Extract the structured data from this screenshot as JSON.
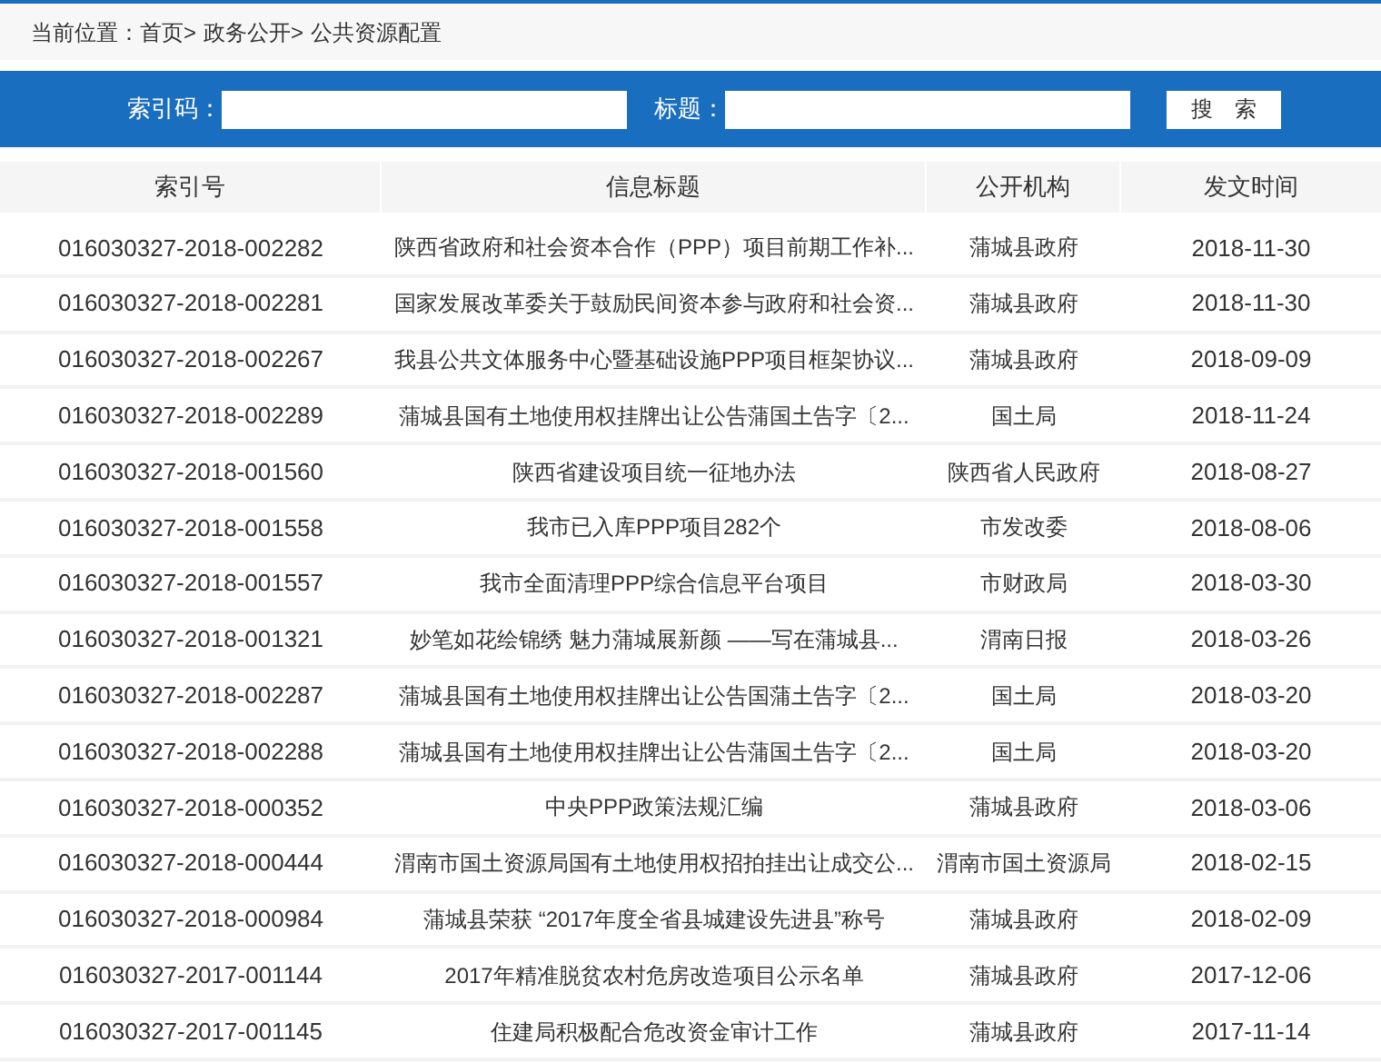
{
  "breadcrumb": {
    "label": "当前位置：",
    "items": [
      "首页>",
      "政务公开>",
      "公共资源配置"
    ]
  },
  "search": {
    "fields": [
      {
        "label": "索引码："
      },
      {
        "label": "标题："
      }
    ],
    "button": "搜　索"
  },
  "table": {
    "columns": [
      "索引号",
      "信息标题",
      "公开机构",
      "发文时间"
    ],
    "rows": [
      [
        "016030327-2018-002282",
        "陕西省政府和社会资本合作（PPP）项目前期工作补...",
        "蒲城县政府",
        "2018-11-30"
      ],
      [
        "016030327-2018-002281",
        "国家发展改革委关于鼓励民间资本参与政府和社会资...",
        "蒲城县政府",
        "2018-11-30"
      ],
      [
        "016030327-2018-002267",
        "我县公共文体服务中心暨基础设施PPP项目框架协议...",
        "蒲城县政府",
        "2018-09-09"
      ],
      [
        "016030327-2018-002289",
        "蒲城县国有土地使用权挂牌出让公告蒲国土告字〔2...",
        "国土局",
        "2018-11-24"
      ],
      [
        "016030327-2018-001560",
        "陕西省建设项目统一征地办法",
        "陕西省人民政府",
        "2018-08-27"
      ],
      [
        "016030327-2018-001558",
        "我市已入库PPP项目282个",
        "市发改委",
        "2018-08-06"
      ],
      [
        "016030327-2018-001557",
        "我市全面清理PPP综合信息平台项目",
        "市财政局",
        "2018-03-30"
      ],
      [
        "016030327-2018-001321",
        "妙笔如花绘锦绣 魅力蒲城展新颜 ——写在蒲城县...",
        "渭南日报",
        "2018-03-26"
      ],
      [
        "016030327-2018-002287",
        "蒲城县国有土地使用权挂牌出让公告国蒲土告字〔2...",
        "国土局",
        "2018-03-20"
      ],
      [
        "016030327-2018-002288",
        "蒲城县国有土地使用权挂牌出让公告蒲国土告字〔2...",
        "国土局",
        "2018-03-20"
      ],
      [
        "016030327-2018-000352",
        "中央PPP政策法规汇编",
        "蒲城县政府",
        "2018-03-06"
      ],
      [
        "016030327-2018-000444",
        "渭南市国土资源局国有土地使用权招拍挂出让成交公...",
        "渭南市国土资源局",
        "2018-02-15"
      ],
      [
        "016030327-2018-000984",
        "蒲城县荣获 “2017年度全省县城建设先进县”称号",
        "蒲城县政府",
        "2018-02-09"
      ],
      [
        "016030327-2017-001144",
        "2017年精准脱贫农村危房改造项目公示名单",
        "蒲城县政府",
        "2017-12-06"
      ],
      [
        "016030327-2017-001145",
        "住建局积极配合危改资金审计工作",
        "蒲城县政府",
        "2017-11-14"
      ]
    ]
  }
}
